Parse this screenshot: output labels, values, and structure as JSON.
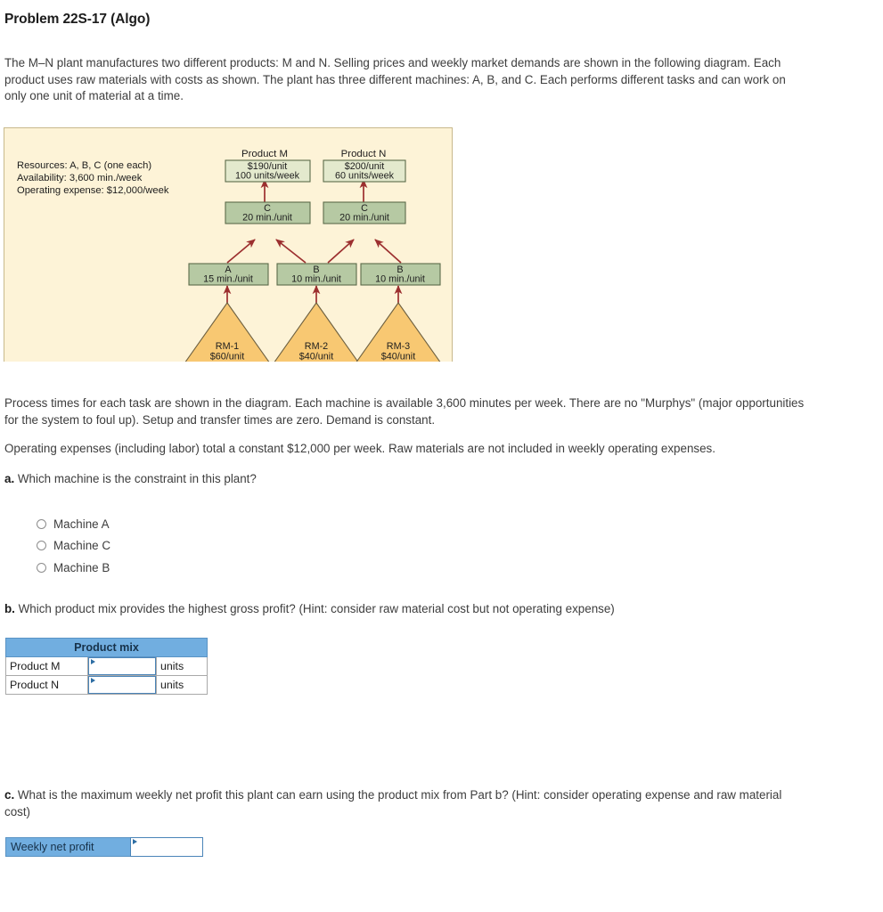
{
  "header": {
    "title": "Problem 22S-17 (Algo)",
    "intro": "The M–N plant manufactures two different products: M and N. Selling prices and weekly market demands are shown in the following diagram. Each product uses raw materials with costs as shown. The plant has three different machines: A, B, and C. Each performs different tasks and can work on only one unit of material at a time."
  },
  "figure": {
    "resources_line1": "Resources:  A, B, C (one each)",
    "resources_line2": "Availability:  3,600 min./week",
    "resources_line3": "Operating expense:  $12,000/week",
    "product_m": {
      "caption": "Product M",
      "price": "$190/unit",
      "demand": "100 units/week"
    },
    "product_n": {
      "caption": "Product N",
      "price": "$200/unit",
      "demand": "60 units/week"
    },
    "machine_c_m": {
      "name": "C",
      "time": "20 min./unit"
    },
    "machine_c_n": {
      "name": "C",
      "time": "20 min./unit"
    },
    "machine_a": {
      "name": "A",
      "time": "15 min./unit"
    },
    "machine_b1": {
      "name": "B",
      "time": "10 min./unit"
    },
    "machine_b2": {
      "name": "B",
      "time": "10 min./unit"
    },
    "rm1": {
      "name": "RM-1",
      "cost": "$60/unit"
    },
    "rm2": {
      "name": "RM-2",
      "cost": "$40/unit"
    },
    "rm3": {
      "name": "RM-3",
      "cost": "$40/unit"
    },
    "colors": {
      "background": "#fdf3d7",
      "box_light": "#e2e8cc",
      "box_dark": "#b6c9a3",
      "triangle": "#f8c872",
      "arrow": "#9c2f2f",
      "border": "#5c6b4a"
    }
  },
  "body": {
    "paragraph1": "Process times for each task are shown in the diagram. Each machine is available 3,600 minutes per week. There are no \"Murphys\" (major opportunities for the system to foul up). Setup and transfer times are zero. Demand is constant.",
    "paragraph2": "Operating expenses (including labor) total a constant $12,000 per week. Raw materials are not included in weekly operating expenses."
  },
  "question_a": {
    "label": "a.",
    "text": "Which machine is the constraint in this plant?",
    "options": [
      {
        "label": "Machine A",
        "selected": false
      },
      {
        "label": "Machine C",
        "selected": false
      },
      {
        "label": "Machine B",
        "selected": false
      }
    ]
  },
  "question_b": {
    "label": "b.",
    "text": "Which product mix provides the highest gross profit? (Hint: consider raw material cost but not operating expense)",
    "table": {
      "header": "Product mix",
      "rows": [
        {
          "label": "Product M",
          "value": "",
          "unit": "units"
        },
        {
          "label": "Product N",
          "value": "",
          "unit": "units"
        }
      ]
    }
  },
  "question_c": {
    "label": "c.",
    "text": "What is the maximum weekly net profit this plant can earn using the product mix from Part b? (Hint: consider operating expense and raw material cost)",
    "field": {
      "label": "Weekly net profit",
      "value": ""
    }
  },
  "theme": {
    "accent_blue": "#71aee0",
    "input_border": "#4a84b8",
    "text": "#3d3d3d"
  }
}
